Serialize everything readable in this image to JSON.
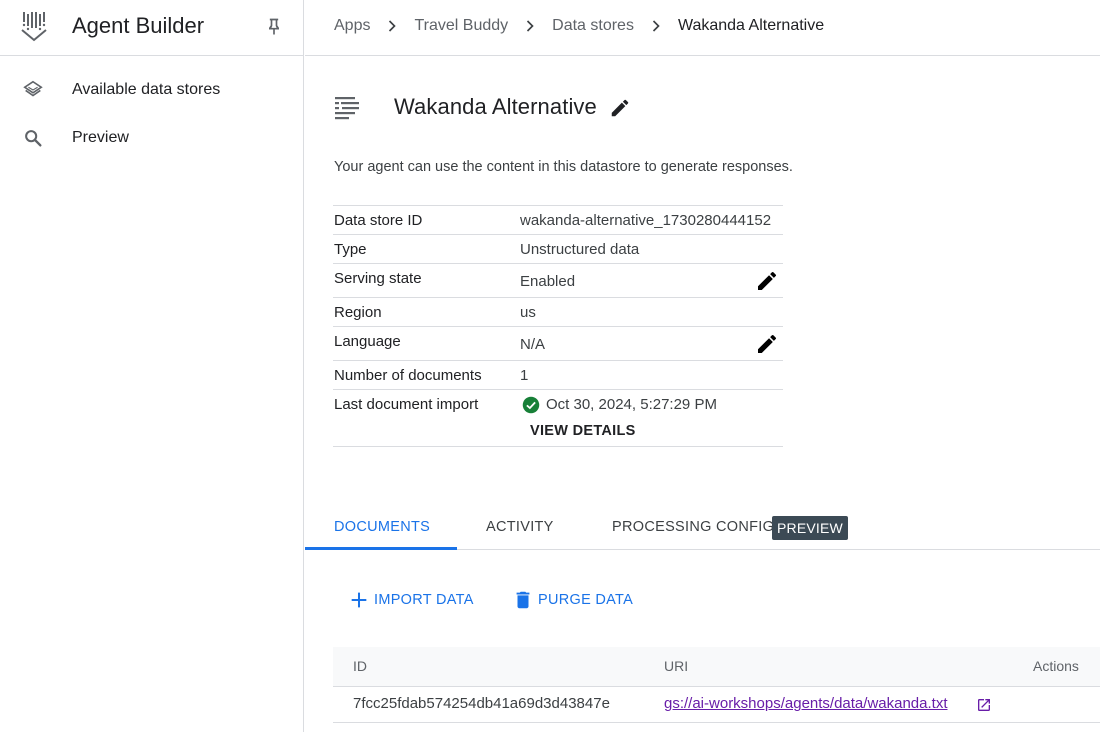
{
  "sidebar": {
    "title": "Agent Builder",
    "items": [
      {
        "label": "Available data stores",
        "icon": "layers-icon"
      },
      {
        "label": "Preview",
        "icon": "search-icon"
      }
    ]
  },
  "breadcrumb": {
    "items": [
      "Apps",
      "Travel Buddy",
      "Data stores"
    ],
    "current": "Wakanda Alternative"
  },
  "datastore": {
    "title": "Wakanda Alternative",
    "description": "Your agent can use the content in this datastore to generate responses.",
    "properties": {
      "id": {
        "label": "Data store ID",
        "value": "wakanda-alternative_1730280444152"
      },
      "type": {
        "label": "Type",
        "value": "Unstructured data"
      },
      "serving_state": {
        "label": "Serving state",
        "value": "Enabled"
      },
      "region": {
        "label": "Region",
        "value": "us"
      },
      "language": {
        "label": "Language",
        "value": "N/A"
      },
      "num_documents": {
        "label": "Number of documents",
        "value": "1"
      },
      "last_import": {
        "label": "Last document import",
        "value": "Oct 30, 2024, 5:27:29 PM",
        "status": "success"
      }
    },
    "view_details_label": "VIEW DETAILS"
  },
  "tabs": {
    "items": [
      "DOCUMENTS",
      "ACTIVITY",
      "PROCESSING CONFIG"
    ],
    "active": "DOCUMENTS",
    "badge": "PREVIEW"
  },
  "actions": {
    "import_label": "IMPORT DATA",
    "purge_label": "PURGE DATA"
  },
  "table": {
    "headers": {
      "id": "ID",
      "uri": "URI",
      "actions": "Actions"
    },
    "rows": [
      {
        "id": "7fcc25fdab574254db41a69d3d43847e",
        "uri": "gs://ai-workshops/agents/data/wakanda.txt"
      }
    ]
  },
  "colors": {
    "accent": "#1a73e8",
    "success": "#188038",
    "link_visited": "#681da8",
    "badge_bg": "#3c4a55"
  }
}
